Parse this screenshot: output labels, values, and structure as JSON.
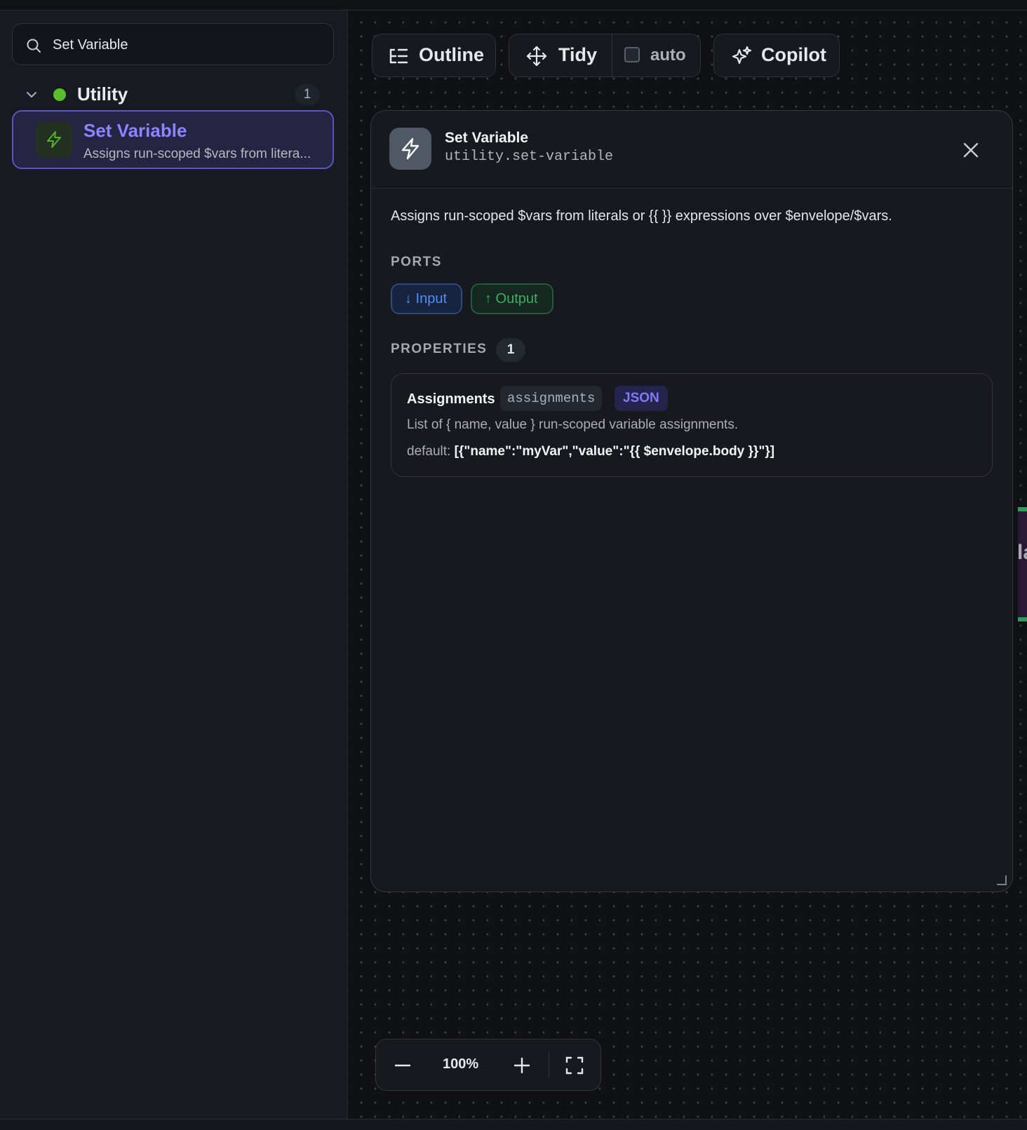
{
  "sidebar": {
    "search": {
      "value": "Set Variable",
      "placeholder": "Search nodes"
    },
    "group": {
      "label": "Utility",
      "count": "1",
      "color": "#5bbf2a"
    },
    "items": [
      {
        "title": "Set Variable",
        "description": "Assigns run-scoped $vars from litera..."
      }
    ]
  },
  "toolbar": {
    "outline_label": "Outline",
    "tidy_label": "Tidy",
    "auto_label": "auto",
    "auto_checked": false,
    "copilot_label": "Copilot"
  },
  "inspector": {
    "title": "Set Variable",
    "type_key": "utility.set-variable",
    "description": "Assigns run-scoped $vars from literals or {{ }} expressions over $envelope/$vars.",
    "ports_heading": "PORTS",
    "ports": {
      "input": "↓ Input",
      "output": "↑ Output"
    },
    "properties_heading": "PROPERTIES",
    "properties_count": "1",
    "properties": [
      {
        "name": "Assignments",
        "key": "assignments",
        "type": "JSON",
        "description": "List of { name, value } run-scoped variable assignments.",
        "default_label": "default:",
        "default_value": "[{\"name\":\"myVar\",\"value\":\"{{ $envelope.body }}\"}]"
      }
    ]
  },
  "canvas": {
    "peek_text": "la"
  },
  "zoom": {
    "value": "100%"
  },
  "colors": {
    "accent": "#8d84ff",
    "input_port": "#4d8dfa",
    "output_port": "#3fae65",
    "node_edge": "#2f9e5c"
  }
}
